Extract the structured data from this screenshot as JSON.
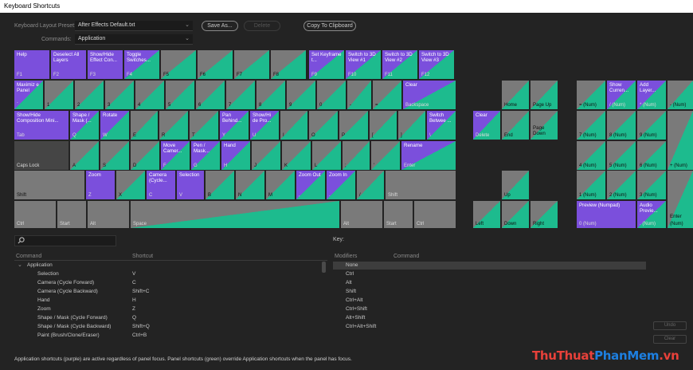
{
  "window": {
    "title": "Keyboard Shortcuts"
  },
  "header": {
    "preset_label": "Keyboard Layout Preset:",
    "preset_value": "After Effects Default.txt",
    "commands_label": "Commands:",
    "commands_value": "Application",
    "save_as": "Save As...",
    "delete": "Delete",
    "copy_clipboard": "Copy To Clipboard"
  },
  "keys": {
    "f1": {
      "top": "Help",
      "bot": "F1"
    },
    "f2": {
      "top": "Deselect All Layers",
      "bot": "F2"
    },
    "f3": {
      "top": "Show/Hide Effect Con...",
      "bot": "F3"
    },
    "f4": {
      "top": "Toggle Switches...",
      "bot": "F4"
    },
    "f5": {
      "bot": "F5"
    },
    "f6": {
      "bot": "F6"
    },
    "f7": {
      "bot": "F7"
    },
    "f8": {
      "bot": "F8"
    },
    "f9": {
      "top": "Set Keyframe t...",
      "bot": "F9"
    },
    "f10": {
      "top": "Switch to 3D View #1",
      "bot": "F10"
    },
    "f11": {
      "top": "Switch to 3D View #2",
      "bot": "F11"
    },
    "f12": {
      "top": "Switch to 3D View #3",
      "bot": "F12"
    },
    "grave": {
      "top": "Maximiz e Panel",
      "bot": "`"
    },
    "n1": {
      "bot": "1"
    },
    "n2": {
      "bot": "2"
    },
    "n3": {
      "bot": "3"
    },
    "n4": {
      "bot": "4"
    },
    "n5": {
      "bot": "5"
    },
    "n6": {
      "bot": "6"
    },
    "n7": {
      "bot": "7"
    },
    "n8": {
      "bot": "8"
    },
    "n9": {
      "bot": "9"
    },
    "n0": {
      "bot": "0"
    },
    "minus": {
      "bot": "-"
    },
    "equals": {
      "bot": "="
    },
    "backspace": {
      "top": "Clear",
      "bot": "Backspace"
    },
    "tab": {
      "top": "Show/Hide Composition Mini...",
      "bot": "Tab"
    },
    "q": {
      "top": "Shape / Mask (...",
      "bot": "Q"
    },
    "w": {
      "top": "Rotate",
      "bot": "W"
    },
    "e": {
      "bot": "E"
    },
    "r": {
      "bot": "R"
    },
    "t": {
      "bot": "T"
    },
    "y": {
      "top": "Pan Behind...",
      "bot": "Y"
    },
    "u": {
      "top": "Show/Hi de Pro...",
      "bot": "U"
    },
    "i": {
      "bot": "I"
    },
    "o": {
      "bot": "O"
    },
    "p": {
      "bot": "P"
    },
    "lbracket": {
      "bot": "["
    },
    "rbracket": {
      "bot": "]"
    },
    "backslash": {
      "top": "Switch Betwee ...",
      "bot": "\\"
    },
    "capslock": {
      "bot": "Caps Lock"
    },
    "a": {
      "bot": "A"
    },
    "s": {
      "bot": "S"
    },
    "d": {
      "bot": "D"
    },
    "f": {
      "top": "Move Camer...",
      "bot": "F"
    },
    "g": {
      "top": "Pen / Mask...",
      "bot": "G"
    },
    "h": {
      "top": "Hand",
      "bot": "H"
    },
    "j": {
      "bot": "J"
    },
    "k": {
      "bot": "K"
    },
    "l": {
      "bot": "L"
    },
    "semicolon": {
      "bot": ";"
    },
    "quote": {
      "bot": "'"
    },
    "enter": {
      "top": "Rename",
      "bot": "Enter"
    },
    "lshift": {
      "bot": "Shift"
    },
    "z": {
      "top": "Zoom",
      "bot": "Z"
    },
    "x": {
      "bot": "X"
    },
    "c": {
      "top": "Camera (Cycle...",
      "bot": "C"
    },
    "v": {
      "top": "Selection",
      "bot": "V"
    },
    "b": {
      "bot": "B"
    },
    "n": {
      "bot": "N"
    },
    "m": {
      "bot": "M"
    },
    "comma": {
      "top": "Zoom Out",
      "bot": ","
    },
    "period": {
      "top": "Zoom In",
      "bot": "."
    },
    "slash": {
      "bot": "/"
    },
    "rshift": {
      "bot": "Shift"
    },
    "lctrl": {
      "bot": "Ctrl"
    },
    "lstart": {
      "bot": "Start"
    },
    "lalt": {
      "bot": "Alt"
    },
    "space": {
      "bot": "Space"
    },
    "ralt": {
      "bot": "Alt"
    },
    "rstart": {
      "bot": "Start"
    },
    "menu": {
      "bot": ""
    },
    "rctrl": {
      "bot": "Ctrl"
    },
    "delete": {
      "top": "Clear",
      "bot": "Delete"
    },
    "end": {
      "bot": "End"
    },
    "pagedown": {
      "top": "Page Down"
    },
    "home": {
      "bot": "Home"
    },
    "pageup": {
      "bot": "Page Up"
    },
    "up": {
      "bot": "Up"
    },
    "left": {
      "bot": "Left"
    },
    "down": {
      "bot": "Down"
    },
    "right": {
      "bot": "Right"
    },
    "numeq": {
      "bot": "= (Num)"
    },
    "numdiv": {
      "top": "Show Curren...",
      "bot": "/ (Num)"
    },
    "nummul": {
      "top": "Add Layer...",
      "bot": "* (Num)"
    },
    "numminus": {
      "bot": "- (Num)"
    },
    "num7": {
      "bot": "7 (Num)"
    },
    "num8": {
      "bot": "8 (Num)"
    },
    "num9": {
      "bot": "9 (Num)"
    },
    "num4": {
      "bot": "4 (Num)"
    },
    "num5": {
      "bot": "5 (Num)"
    },
    "num6": {
      "bot": "6 (Num)"
    },
    "numplus": {
      "bot": "+ (Num)"
    },
    "num1": {
      "bot": "1 (Num)"
    },
    "num2": {
      "bot": "2 (Num)"
    },
    "num3": {
      "bot": "3 (Num)"
    },
    "num0": {
      "top": "Preview (Numpad)",
      "bot": "0 (Num)"
    },
    "numdot": {
      "top": "Audio Previe...",
      "bot": ". (Num)"
    },
    "numenter": {
      "top": "Enter",
      "bot": "(Num)"
    }
  },
  "key_panel": {
    "label": "Key:"
  },
  "command_table": {
    "col_command": "Command",
    "col_shortcut": "Shortcut",
    "group": "Application",
    "rows": [
      {
        "command": "Selection",
        "shortcut": "V"
      },
      {
        "command": "Camera (Cycle Forward)",
        "shortcut": "C"
      },
      {
        "command": "Camera (Cycle Backward)",
        "shortcut": "Shift+C"
      },
      {
        "command": "Hand",
        "shortcut": "H"
      },
      {
        "command": "Zoom",
        "shortcut": "Z"
      },
      {
        "command": "Shape / Mask (Cycle Forward)",
        "shortcut": "Q"
      },
      {
        "command": "Shape / Mask (Cycle Backward)",
        "shortcut": "Shift+Q"
      },
      {
        "command": "Paint (Brush/Clone/Eraser)",
        "shortcut": "Ctrl+B"
      }
    ]
  },
  "modifier_table": {
    "col_modifiers": "Modifiers",
    "col_command": "Command",
    "rows": [
      "None",
      "Ctrl",
      "Alt",
      "Shift",
      "Ctrl+Alt",
      "Ctrl+Shift",
      "Alt+Shift",
      "Ctrl+Alt+Shift"
    ]
  },
  "side_buttons": {
    "undo": "Undo",
    "clear": "Clear"
  },
  "footer": "Application shortcuts (purple) are active regardless of panel focus. Panel shortcuts (green) override Application shortcuts when the panel has focus.",
  "watermark": {
    "a": "ThuThuat",
    "b": "PhanMem",
    "c": ".vn"
  },
  "colors": {
    "purple": "#7b4fdc",
    "green": "#1dbb8e",
    "grey_key": "#7a7a7a",
    "background": "#232323"
  }
}
